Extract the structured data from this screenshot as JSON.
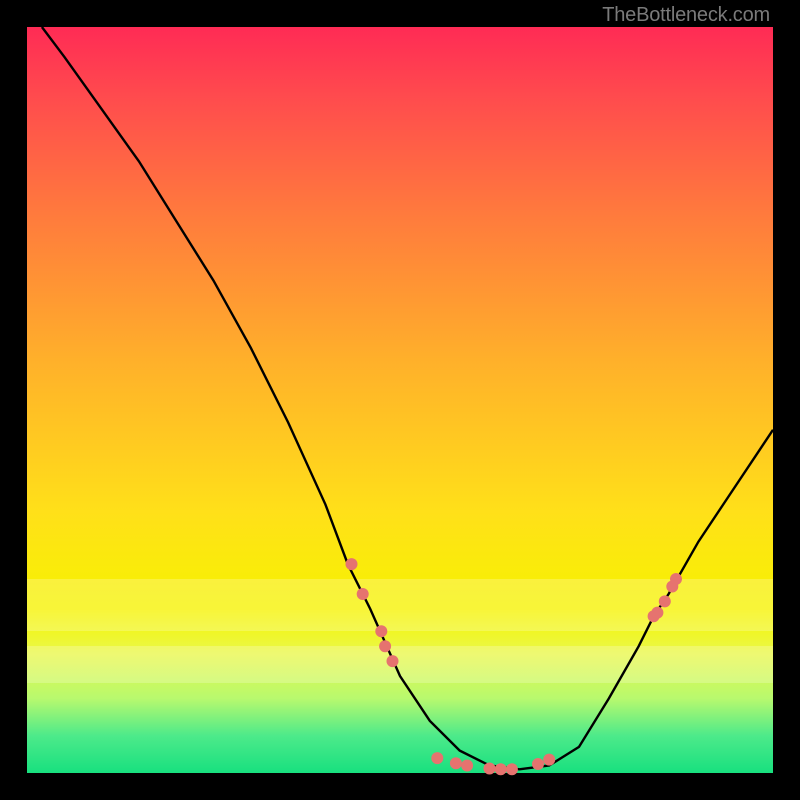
{
  "attribution": "TheBottleneck.com",
  "chart_data": {
    "type": "line",
    "title": "",
    "xlabel": "",
    "ylabel": "",
    "xlim": [
      0,
      100
    ],
    "ylim": [
      0,
      100
    ],
    "grid": false,
    "curve": {
      "x": [
        2,
        5,
        10,
        15,
        20,
        25,
        30,
        35,
        40,
        43,
        46,
        50,
        54,
        58,
        62,
        66,
        70,
        74,
        78,
        82,
        84,
        86,
        90,
        94,
        98,
        100
      ],
      "y": [
        100,
        96,
        89,
        82,
        74,
        66,
        57,
        47,
        36,
        28,
        22,
        13,
        7,
        3,
        1,
        0.5,
        1,
        3.5,
        10,
        17,
        21,
        24,
        31,
        37,
        43,
        46
      ],
      "stroke": "#000000"
    },
    "markers": {
      "shape": "circle",
      "color": "#e6736f",
      "radius": 6,
      "points": [
        {
          "x": 43.5,
          "y": 28.0
        },
        {
          "x": 45.0,
          "y": 24.0
        },
        {
          "x": 47.5,
          "y": 19.0
        },
        {
          "x": 48.0,
          "y": 17.0
        },
        {
          "x": 49.0,
          "y": 15.0
        },
        {
          "x": 55.0,
          "y": 2.0
        },
        {
          "x": 57.5,
          "y": 1.3
        },
        {
          "x": 59.0,
          "y": 1.0
        },
        {
          "x": 62.0,
          "y": 0.6
        },
        {
          "x": 63.5,
          "y": 0.5
        },
        {
          "x": 65.0,
          "y": 0.5
        },
        {
          "x": 68.5,
          "y": 1.2
        },
        {
          "x": 70.0,
          "y": 1.8
        },
        {
          "x": 84.0,
          "y": 21.0
        },
        {
          "x": 85.5,
          "y": 23.0
        },
        {
          "x": 86.5,
          "y": 25.0
        },
        {
          "x": 87.0,
          "y": 26.0
        },
        {
          "x": 84.5,
          "y": 21.5
        }
      ]
    },
    "pale_bands": [
      {
        "y_top": 26.0,
        "y_bottom": 19.0
      },
      {
        "y_top": 17.0,
        "y_bottom": 12.0
      }
    ]
  },
  "colors": {
    "marker": "#e6736f"
  }
}
